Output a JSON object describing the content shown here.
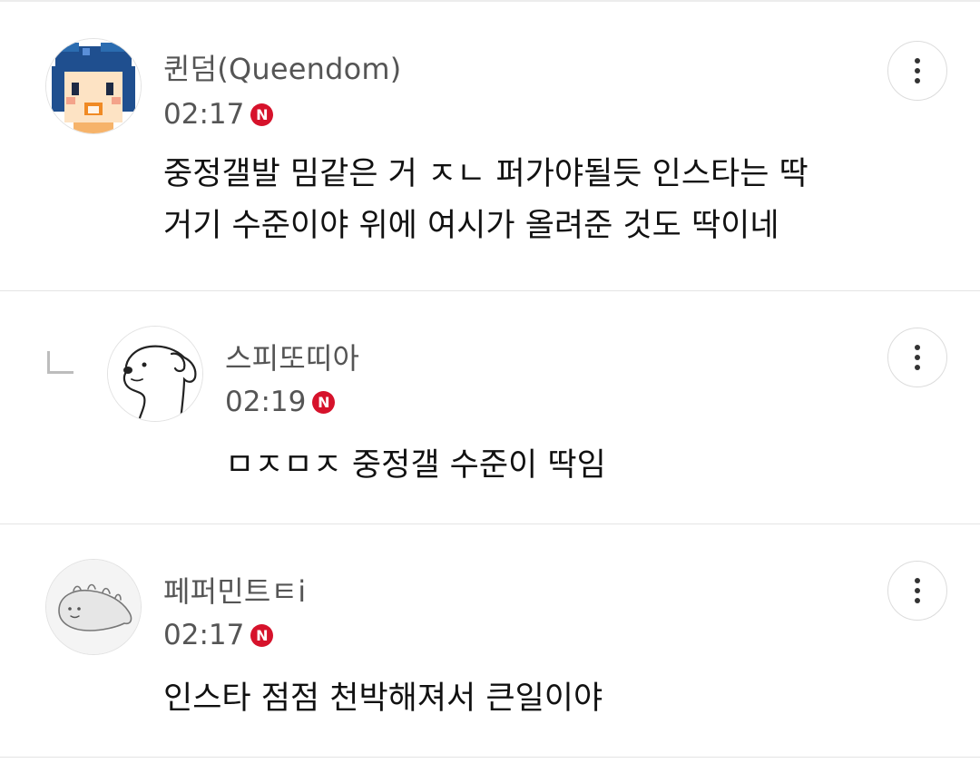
{
  "comments": [
    {
      "author": "퀸덤(Queendom)",
      "time": "02:17",
      "badge": "N",
      "text": "중정갤발 밈같은 거 ㅈㄴ 퍼가야될듯 인스타는 딱\n거기 수준이야 위에 여시가 올려준 것도 딱이네",
      "avatar_icon": "pixel-girl-avatar-icon",
      "is_reply": false
    },
    {
      "author": "스피또띠아",
      "time": "02:19",
      "badge": "N",
      "text": "ㅁㅈㅁㅈ 중정갤 수준이 딱임",
      "avatar_icon": "dog-sketch-avatar-icon",
      "is_reply": true
    },
    {
      "author": "페퍼민트ㅌi",
      "time": "02:17",
      "badge": "N",
      "text": "인스타 점점 천박해져서 큰일이야",
      "avatar_icon": "seal-creature-avatar-icon",
      "is_reply": false
    }
  ],
  "colors": {
    "badge": "#d6122b",
    "author_text": "#555555",
    "body_text": "#111111",
    "divider": "#e4e4e4"
  }
}
